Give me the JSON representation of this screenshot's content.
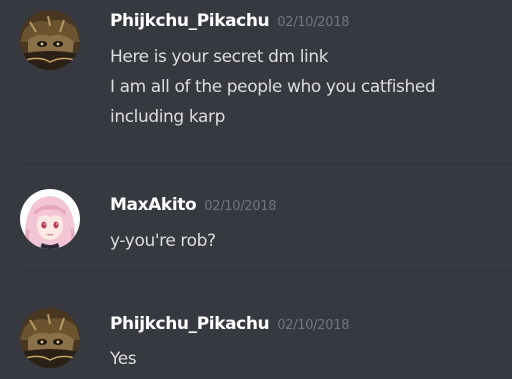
{
  "messages": [
    {
      "author": "Phijkchu_Pikachu",
      "timestamp": "02/10/2018",
      "avatar_icon": "dark-anime-avatar-icon",
      "lines": [
        "Here is your secret dm link",
        "I am all of the people who you catfished",
        "including karp"
      ]
    },
    {
      "author": "MaxAkito",
      "timestamp": "02/10/2018",
      "avatar_icon": "pink-hair-anime-girl-avatar-icon",
      "lines": [
        "y-you're rob?"
      ]
    },
    {
      "author": "Phijkchu_Pikachu",
      "timestamp": "02/10/2018",
      "avatar_icon": "dark-anime-avatar-icon",
      "lines": [
        "Yes"
      ]
    }
  ],
  "colors": {
    "background": "#36393f",
    "username": "#ffffff",
    "timestamp": "#72767d",
    "message_text": "#dcddde",
    "divider": "#2f3136"
  }
}
